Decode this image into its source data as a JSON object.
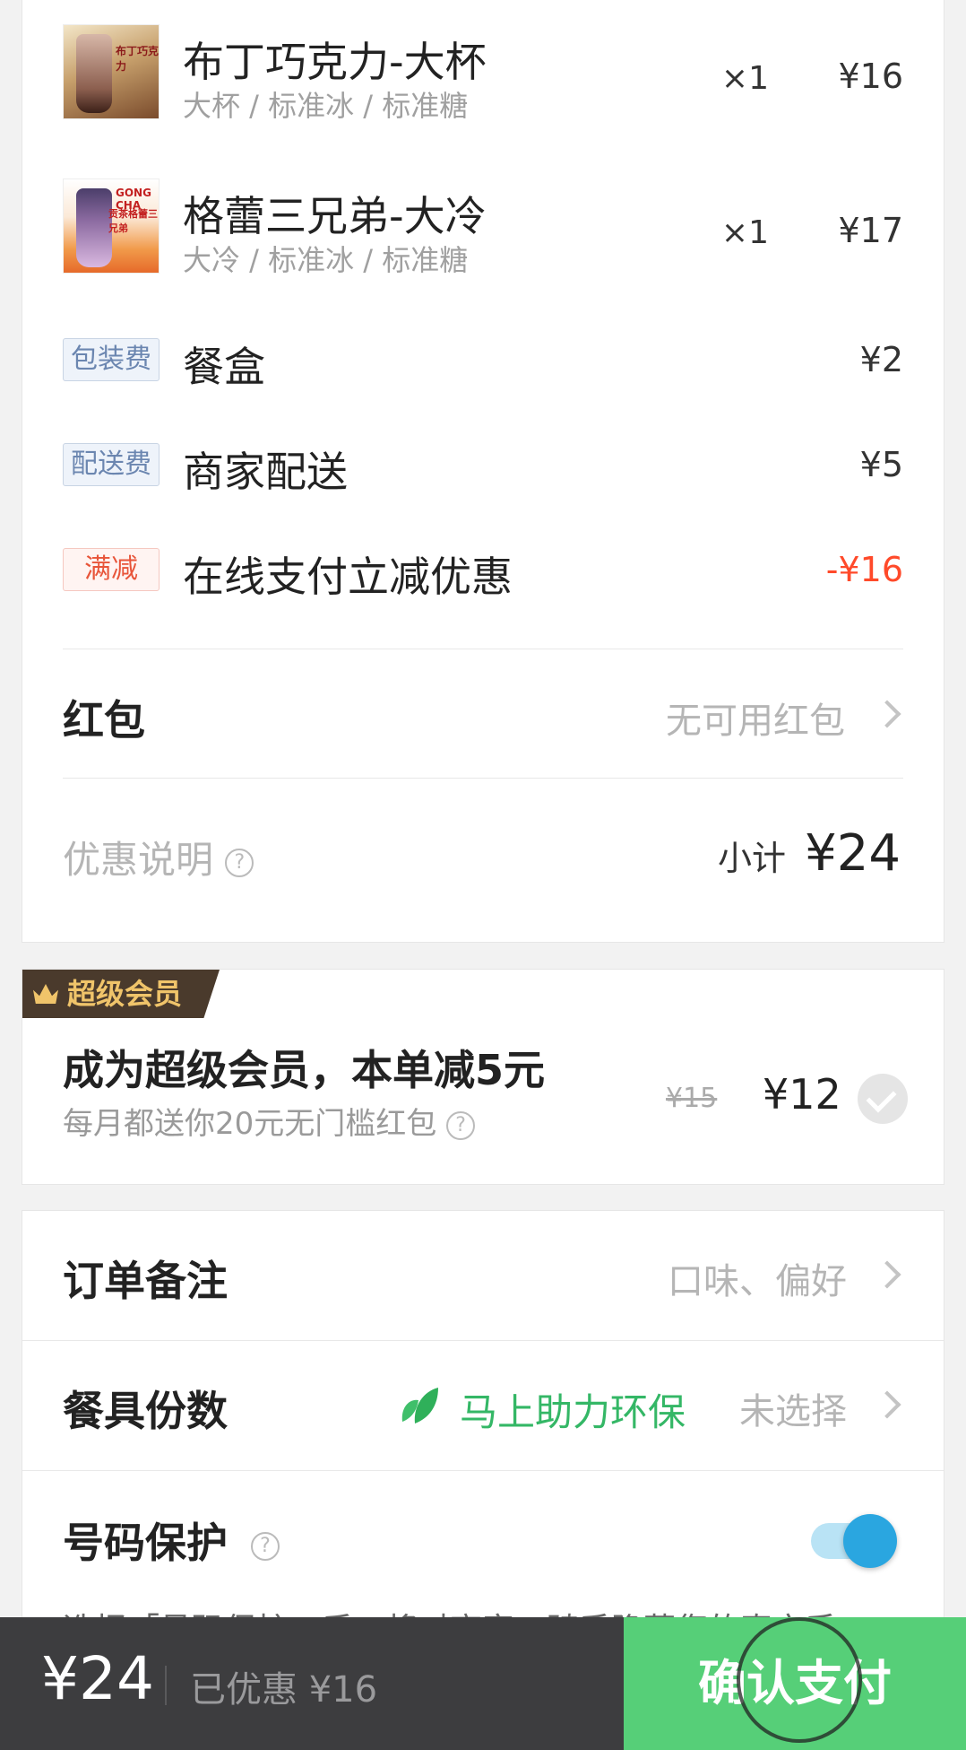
{
  "items": [
    {
      "name": "布丁巧克力-大杯",
      "spec": "大杯 / 标准冰 / 标准糖",
      "qty": "×1",
      "price": "¥16",
      "thumb_brand": "布丁巧克力"
    },
    {
      "name": "格蕾三兄弟-大冷",
      "spec": "大冷 / 标准冰 / 标准糖",
      "qty": "×1",
      "price": "¥17",
      "thumb_brand": "GONG CHA",
      "thumb_brand2": "贡茶格蕾三兄弟"
    }
  ],
  "fees": [
    {
      "tag": "包装费",
      "label": "餐盒",
      "value": "¥2"
    },
    {
      "tag": "配送费",
      "label": "商家配送",
      "value": "¥5"
    },
    {
      "tag": "满减",
      "label": "在线支付立减优惠",
      "value": "-¥16"
    }
  ],
  "red_packet": {
    "title": "红包",
    "hint": "无可用红包"
  },
  "discount_note": {
    "label": "优惠说明",
    "subtotal_label": "小计",
    "subtotal_value": "¥24"
  },
  "vip": {
    "banner": "超级会员",
    "title": "成为超级会员，本单减5元",
    "subtitle": "每月都送你20元无门槛红包",
    "old_price": "¥15",
    "new_price": "¥12"
  },
  "order_note": {
    "title": "订单备注",
    "hint": "口味、偏好"
  },
  "tableware": {
    "title": "餐具份数",
    "eco": "马上助力环保",
    "hint": "未选择"
  },
  "number_protect": {
    "title": "号码保护",
    "desc": "选择「号码保护」后，将对商家、骑手隐藏您的真实手",
    "enabled": true
  },
  "footer": {
    "total": "¥24",
    "saved": "已优惠 ¥16",
    "pay": "确认支付"
  },
  "colors": {
    "accent_green": "#56cf78",
    "discount_red": "#ff4a2a",
    "toggle_blue": "#2aa6e0"
  }
}
